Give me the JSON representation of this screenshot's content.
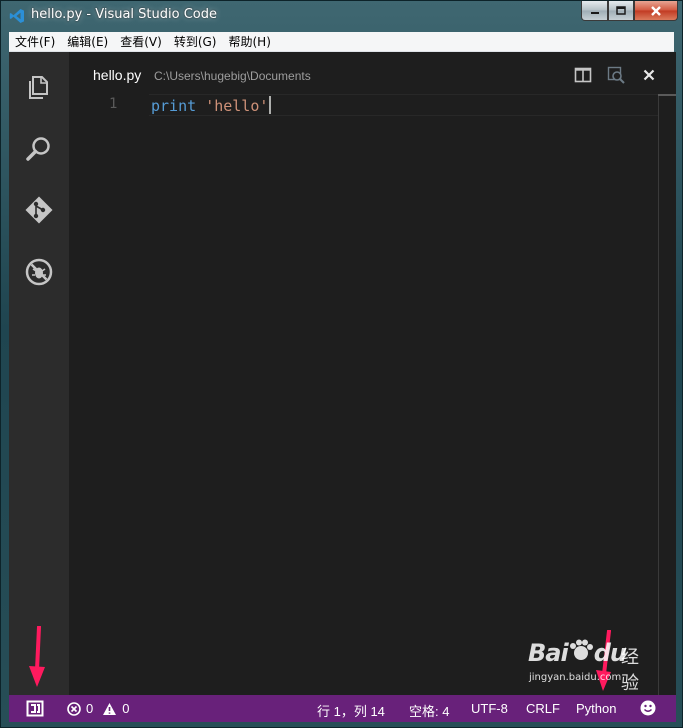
{
  "window": {
    "title": "hello.py - Visual Studio Code"
  },
  "menu": {
    "items": [
      "文件(F)",
      "编辑(E)",
      "查看(V)",
      "转到(G)",
      "帮助(H)"
    ]
  },
  "activity_bar": {
    "icons": [
      "explorer-icon",
      "search-icon",
      "git-icon",
      "debug-icon"
    ]
  },
  "editor": {
    "file_name": "hello.py",
    "file_path": "C:\\Users\\hugebig\\Documents",
    "line_number": "1",
    "code_keyword": "print",
    "code_string": "'hello'"
  },
  "status_bar": {
    "errors": "0",
    "warnings": "0",
    "cursor_position": "行 1，列 14",
    "indentation": "空格: 4",
    "encoding": "UTF-8",
    "line_ending": "CRLF",
    "language": "Python"
  },
  "watermark": {
    "brand": "Bai",
    "brand_tail": "du",
    "brand_cn": "经验",
    "url": "jingyan.baidu.com"
  },
  "colors": {
    "status_bar": "#68217a",
    "editor_bg": "#1e1e1e",
    "activity_bar": "#2c2c2c",
    "keyword": "#569cd6",
    "string": "#ce9178",
    "arrow": "#ff1a5e"
  }
}
